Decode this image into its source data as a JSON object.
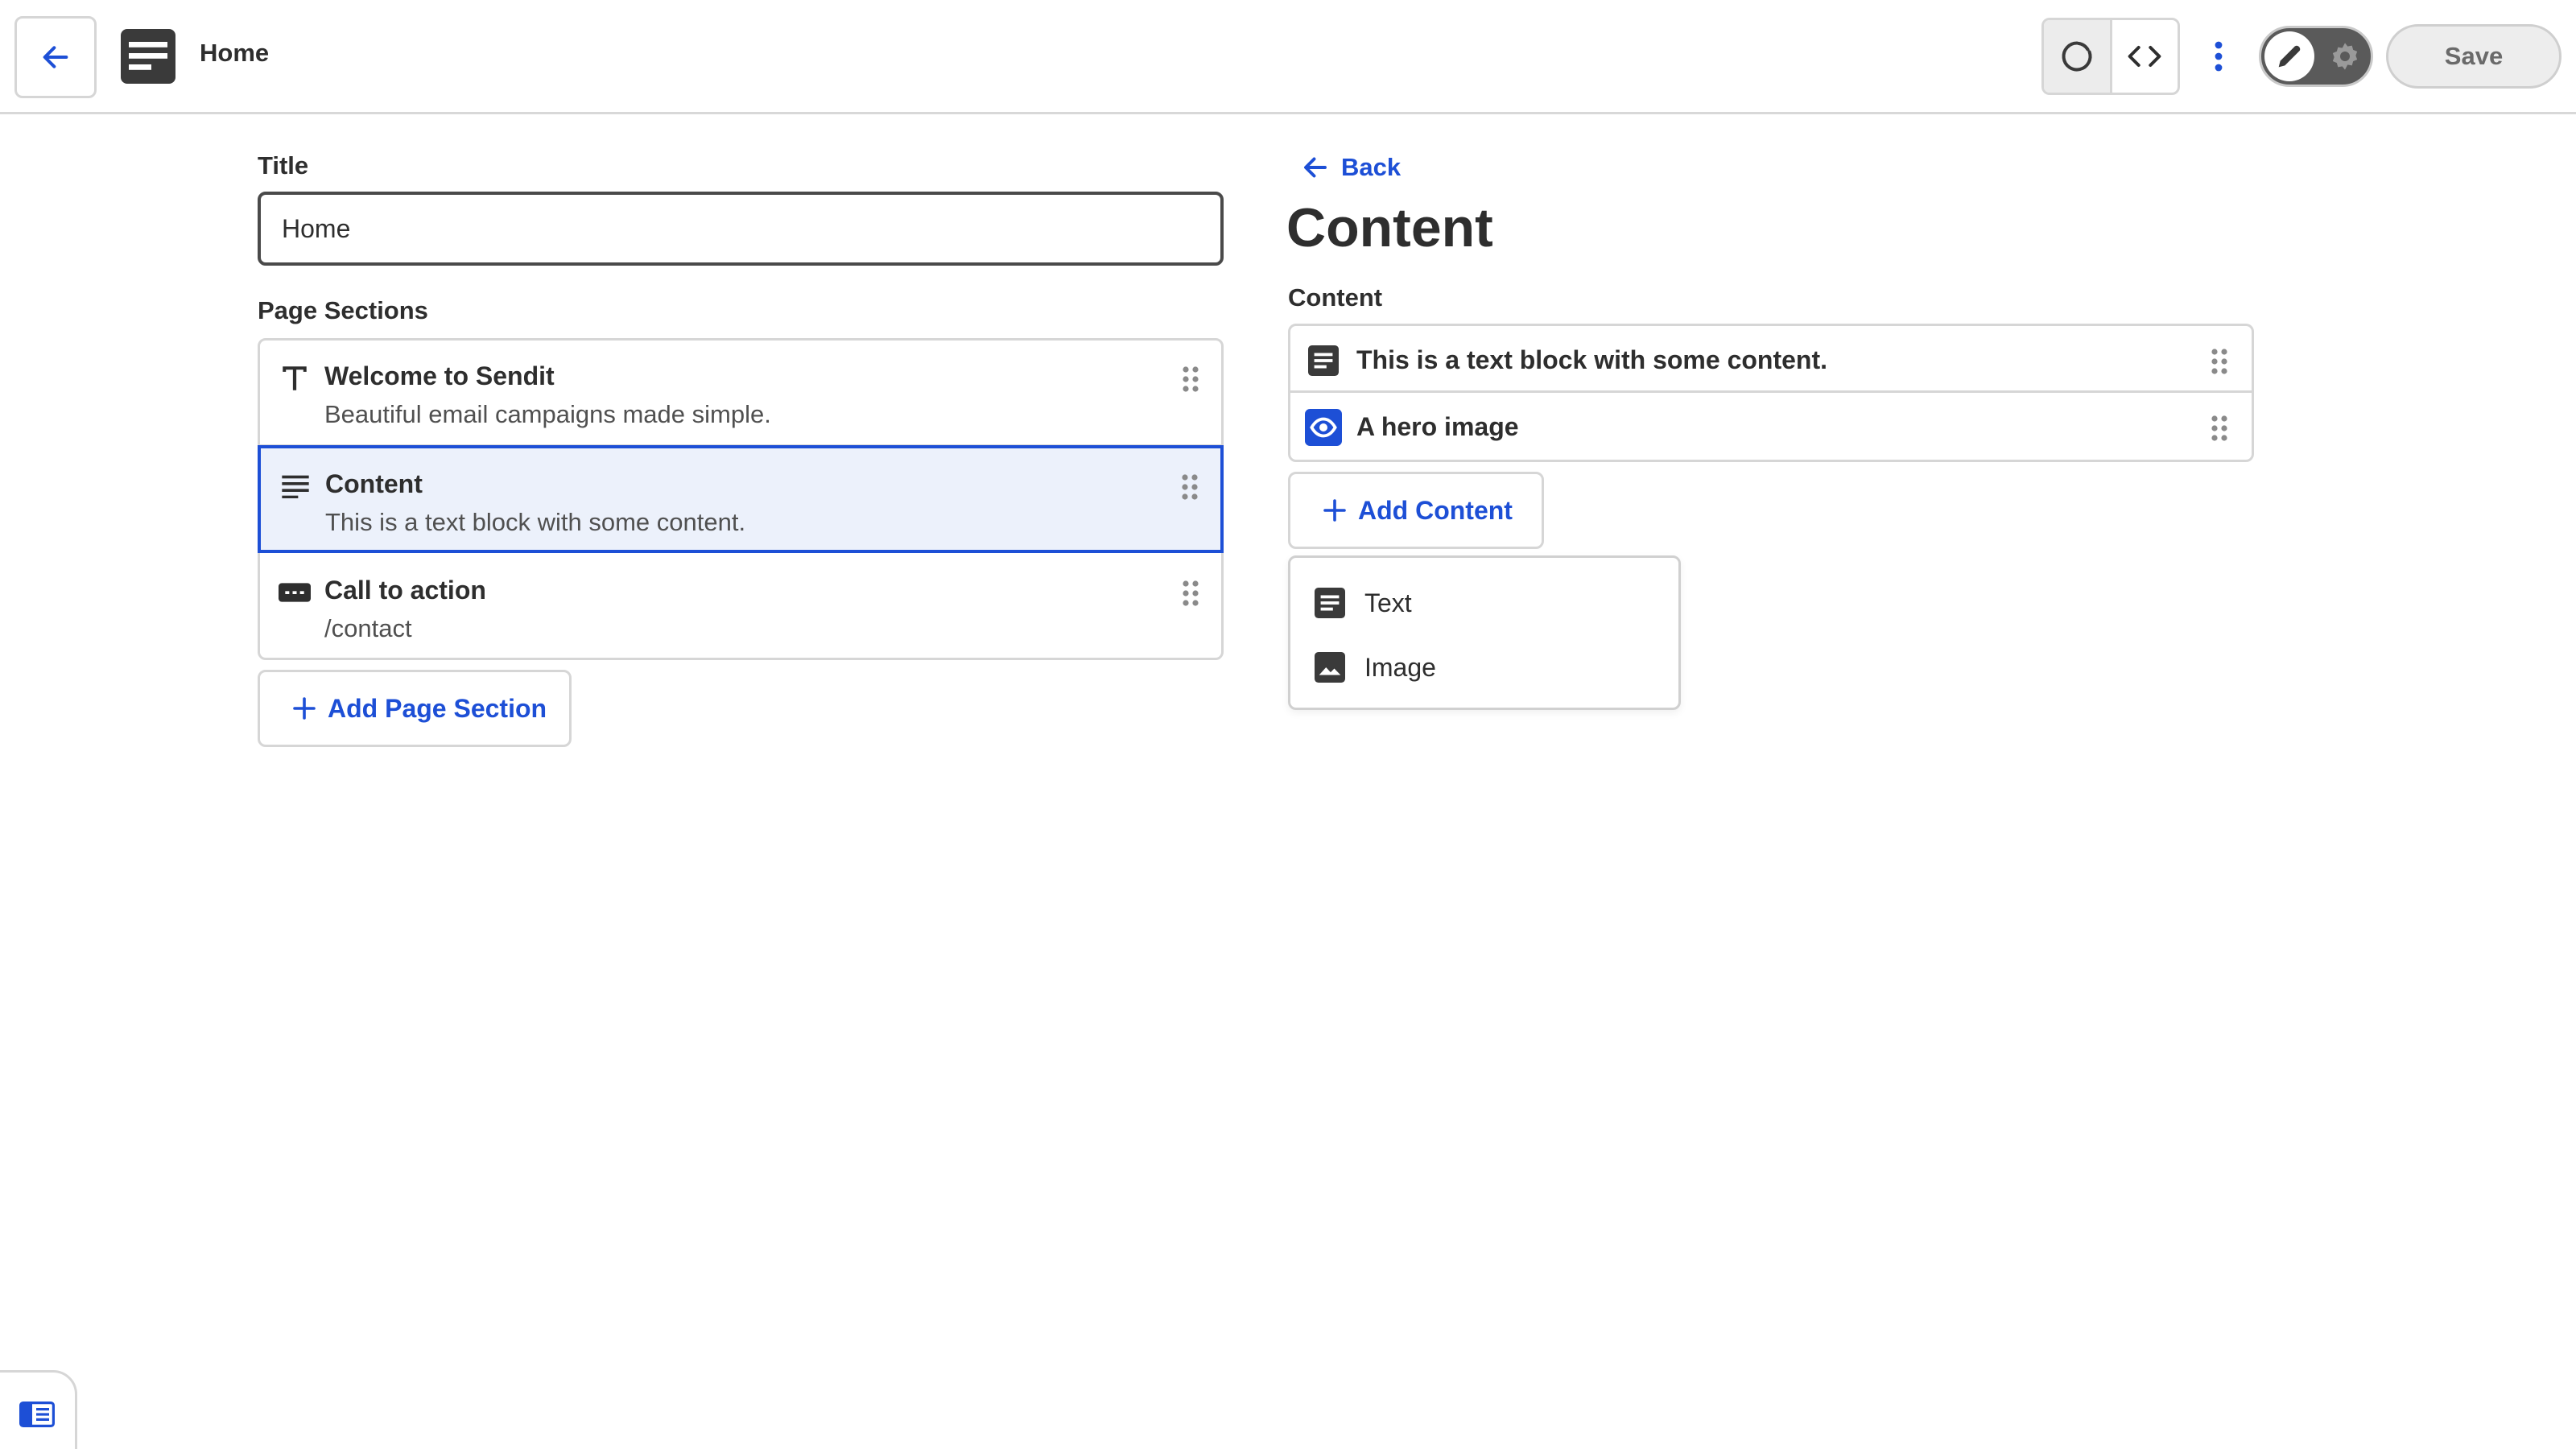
{
  "header": {
    "title": "Home",
    "save_label": "Save",
    "back_icon": "arrow-left-icon",
    "page_icon": "document-icon",
    "view_icons": [
      "refresh-icon",
      "code-icon"
    ],
    "more_icon": "more-vertical-icon",
    "mode_icons": [
      "pencil-icon",
      "gear-icon"
    ]
  },
  "left": {
    "title_label": "Title",
    "title_value": "Home",
    "sections_label": "Page Sections",
    "sections": [
      {
        "title": "Welcome to Sendit",
        "subtitle": "Beautiful email campaigns made simple.",
        "icon": "text-t-icon"
      },
      {
        "title": "Content",
        "subtitle": "This is a text block with some content.",
        "icon": "paragraph-icon",
        "selected": true
      },
      {
        "title": "Call to action",
        "subtitle": "/contact",
        "icon": "button-icon"
      }
    ],
    "add_section_label": "Add Page Section"
  },
  "right": {
    "back_label": "Back",
    "heading": "Content",
    "content_label": "Content",
    "items": [
      {
        "text": "This is a text block with some content.",
        "icon": "text-block-icon"
      },
      {
        "text": "A hero image",
        "icon": "image-block-icon"
      }
    ],
    "add_content_label": "Add Content",
    "menu": [
      {
        "label": "Text",
        "icon": "text-block-icon"
      },
      {
        "label": "Image",
        "icon": "image-icon"
      }
    ]
  },
  "colors": {
    "accent": "#1d4fd6",
    "selected_bg": "#ecf1fb",
    "border": "#d6d6d6",
    "text": "#2e2e2e"
  }
}
